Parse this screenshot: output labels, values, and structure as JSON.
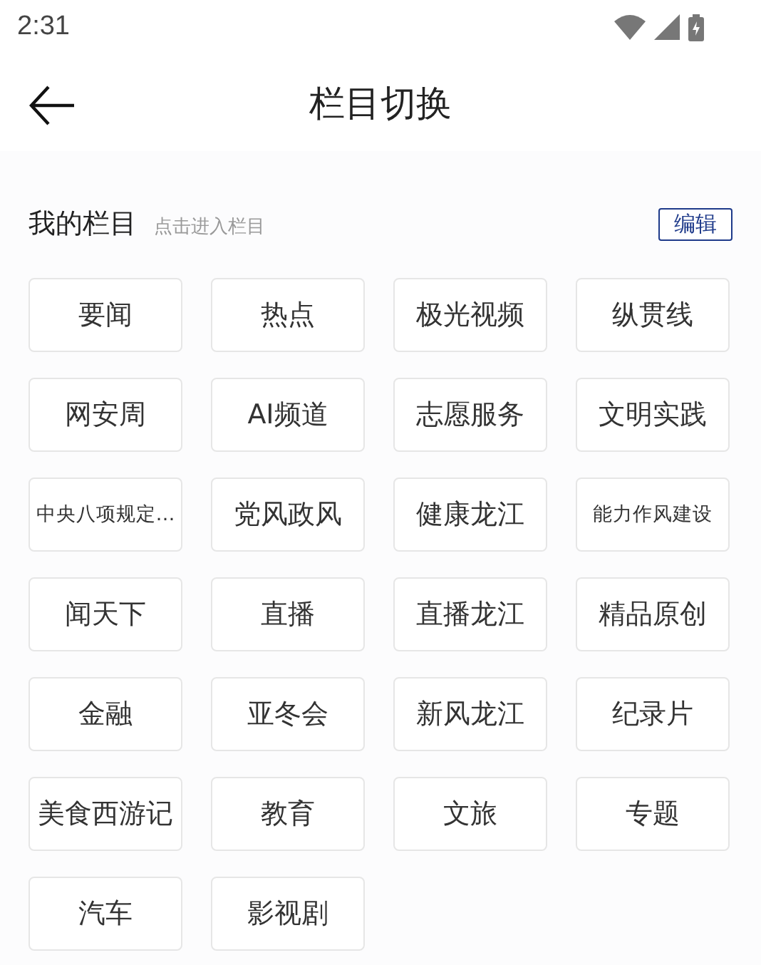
{
  "status_bar": {
    "time": "2:31"
  },
  "header": {
    "title": "栏目切换"
  },
  "section": {
    "title": "我的栏目",
    "hint": "点击进入栏目",
    "edit_button": "编辑"
  },
  "channels": [
    "要闻",
    "热点",
    "极光视频",
    "纵贯线",
    "网安周",
    "AI频道",
    "志愿服务",
    "文明实践",
    "中央八项规定…",
    "党风政风",
    "健康龙江",
    "能力作风建设",
    "闻天下",
    "直播",
    "直播龙江",
    "精品原创",
    "金融",
    "亚冬会",
    "新风龙江",
    "纪录片",
    "美食西游记",
    "教育",
    "文旅",
    "专题",
    "汽车",
    "影视剧"
  ]
}
